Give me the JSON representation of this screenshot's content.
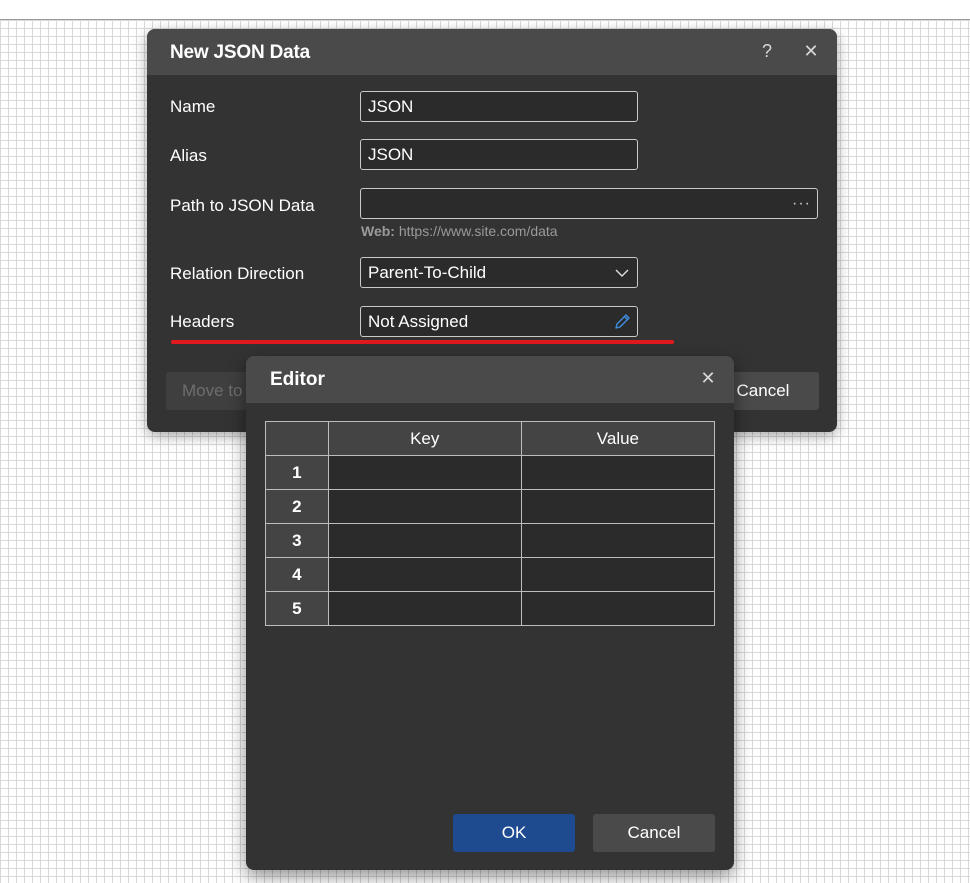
{
  "dialog": {
    "title": "New JSON Data",
    "help_icon": "?",
    "close_icon": "✕",
    "fields": {
      "name": {
        "label": "Name",
        "value": "JSON"
      },
      "alias": {
        "label": "Alias",
        "value": "JSON"
      },
      "path": {
        "label": "Path to JSON Data",
        "value": "",
        "hint_bold": "Web:",
        "hint": "https://www.site.com/data"
      },
      "relation": {
        "label": "Relation Direction",
        "value": "Parent-To-Child"
      },
      "headers": {
        "label": "Headers",
        "value": "Not Assigned"
      }
    },
    "buttons": {
      "move_to": "Move to",
      "cancel": "Cancel"
    },
    "highlight_color": "#e0191f"
  },
  "editor": {
    "title": "Editor",
    "close_icon": "✕",
    "columns": [
      "Key",
      "Value"
    ],
    "rows": [
      {
        "num": "1",
        "key": "",
        "value": ""
      },
      {
        "num": "2",
        "key": "",
        "value": ""
      },
      {
        "num": "3",
        "key": "",
        "value": ""
      },
      {
        "num": "4",
        "key": "",
        "value": ""
      },
      {
        "num": "5",
        "key": "",
        "value": ""
      }
    ],
    "buttons": {
      "ok": "OK",
      "cancel": "Cancel"
    },
    "ok_color": "#1e4b8f"
  }
}
